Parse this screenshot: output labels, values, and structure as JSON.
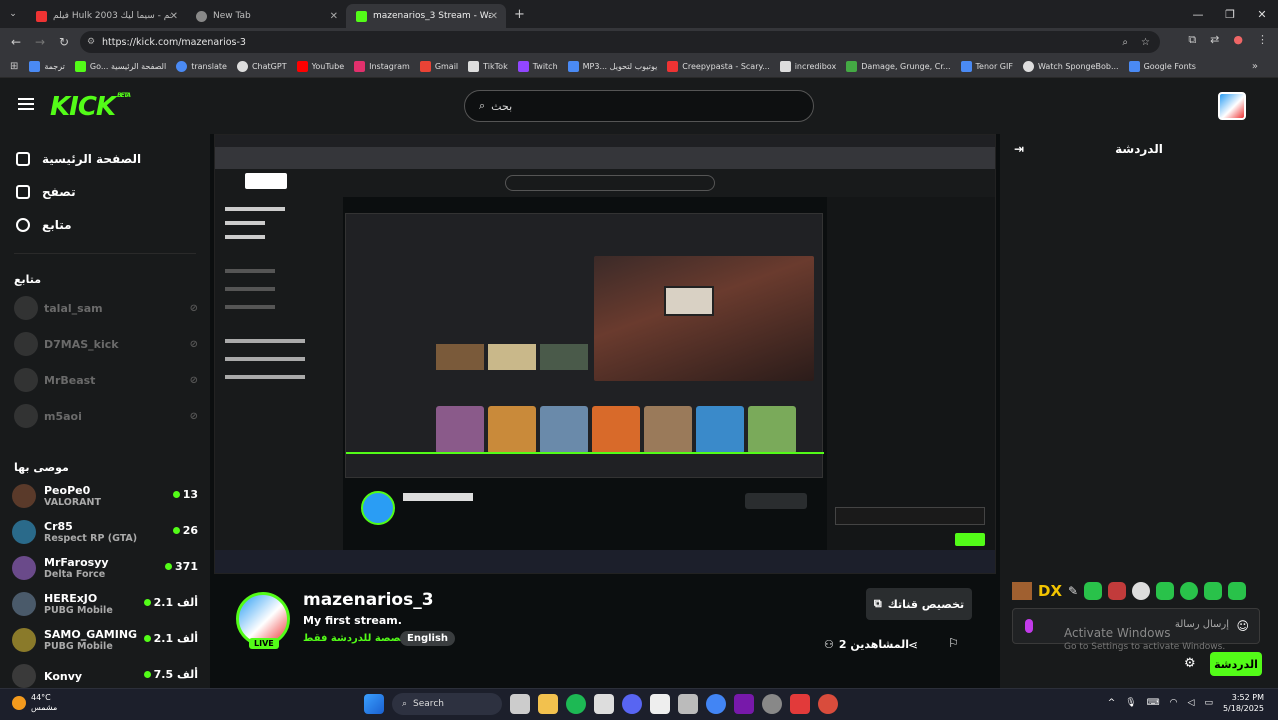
{
  "browser": {
    "tabs": [
      {
        "label": "فيلم Hulk 2003 مترجم - سيما ليك",
        "fav_color": "#e33"
      },
      {
        "label": "New Tab",
        "fav_color": "#888"
      },
      {
        "label": "mazenarios_3 Stream - Wa...",
        "fav_color": "#53fc18"
      }
    ],
    "url": "https://kick.com/mazenarios-3",
    "bookmarks": [
      {
        "label": "ترجمة",
        "color": "#4a8af4"
      },
      {
        "label": "Go... الصفحة الرئيسية",
        "color": "#53fc18"
      },
      {
        "label": "translate",
        "color": "#4a8af4"
      },
      {
        "label": "ChatGPT",
        "color": "#ddd"
      },
      {
        "label": "YouTube",
        "color": "#f00"
      },
      {
        "label": "Instagram",
        "color": "#e1306c"
      },
      {
        "label": "Gmail",
        "color": "#ea4335"
      },
      {
        "label": "TikTok",
        "color": "#ddd"
      },
      {
        "label": "Twitch",
        "color": "#9146ff"
      },
      {
        "label": "MP3... يوتيوب لتحويل",
        "color": "#4a8af4"
      },
      {
        "label": "Creepypasta - Scary...",
        "color": "#e33"
      },
      {
        "label": "incredibox",
        "color": "#ddd"
      },
      {
        "label": "Damage, Grunge, Cr...",
        "color": "#4a4"
      },
      {
        "label": "Tenor GIF",
        "color": "#4a8af4"
      },
      {
        "label": "Watch SpongeBob...",
        "color": "#ddd"
      },
      {
        "label": "Google Fonts",
        "color": "#4a8af4"
      }
    ]
  },
  "header": {
    "logo": "KICK",
    "beta": "BETA",
    "search_placeholder": "بحث"
  },
  "sidebar": {
    "nav": [
      {
        "label": "الصفحة الرئيسية"
      },
      {
        "label": "تصفح"
      },
      {
        "label": "متابع"
      }
    ],
    "following_title": "متابع",
    "following": [
      {
        "name": "talal_sam"
      },
      {
        "name": "D7MAS_kick"
      },
      {
        "name": "MrBeast"
      },
      {
        "name": "m5aoi"
      }
    ],
    "recommended_title": "موصى بها",
    "recommended": [
      {
        "name": "PeoPe0",
        "category": "VALORANT",
        "viewers": "13",
        "color": "#5a3a2a"
      },
      {
        "name": "Cr85",
        "category": "Respect RP (GTA)",
        "viewers": "26",
        "color": "#2a6a8a"
      },
      {
        "name": "MrFarosyy",
        "category": "Delta Force",
        "viewers": "371",
        "color": "#6a4a8a"
      },
      {
        "name": "HERExJO",
        "category": "PUBG Mobile",
        "viewers": "2.1 ألف",
        "color": "#4a5a6a"
      },
      {
        "name": "SAMO_GAMING",
        "category": "PUBG Mobile",
        "viewers": "2.1 ألف",
        "color": "#8a7a2a"
      },
      {
        "name": "Konvy",
        "category": "",
        "viewers": "7.5 ألف",
        "color": "#3a3a3a"
      }
    ]
  },
  "stream": {
    "streamer": "mazenarios_3",
    "live_badge": "LIVE",
    "title": "My first stream.",
    "category": "مخصصة للدردشة فقط",
    "language": "English",
    "customize_label": "تخصيص قناتك",
    "viewers_label": "المشاهدين 2"
  },
  "chat": {
    "title": "الدردشة",
    "badge_text": "DX",
    "message_placeholder": "إرسال رسالة",
    "activate_title": "Activate Windows",
    "activate_sub": "Go to Settings to activate Windows.",
    "send_label": "الدردشة"
  },
  "taskbar": {
    "temperature": "44°C",
    "weather_text": "مشمس",
    "search_label": "Search",
    "time": "3:52 PM",
    "date": "5/18/2025"
  }
}
